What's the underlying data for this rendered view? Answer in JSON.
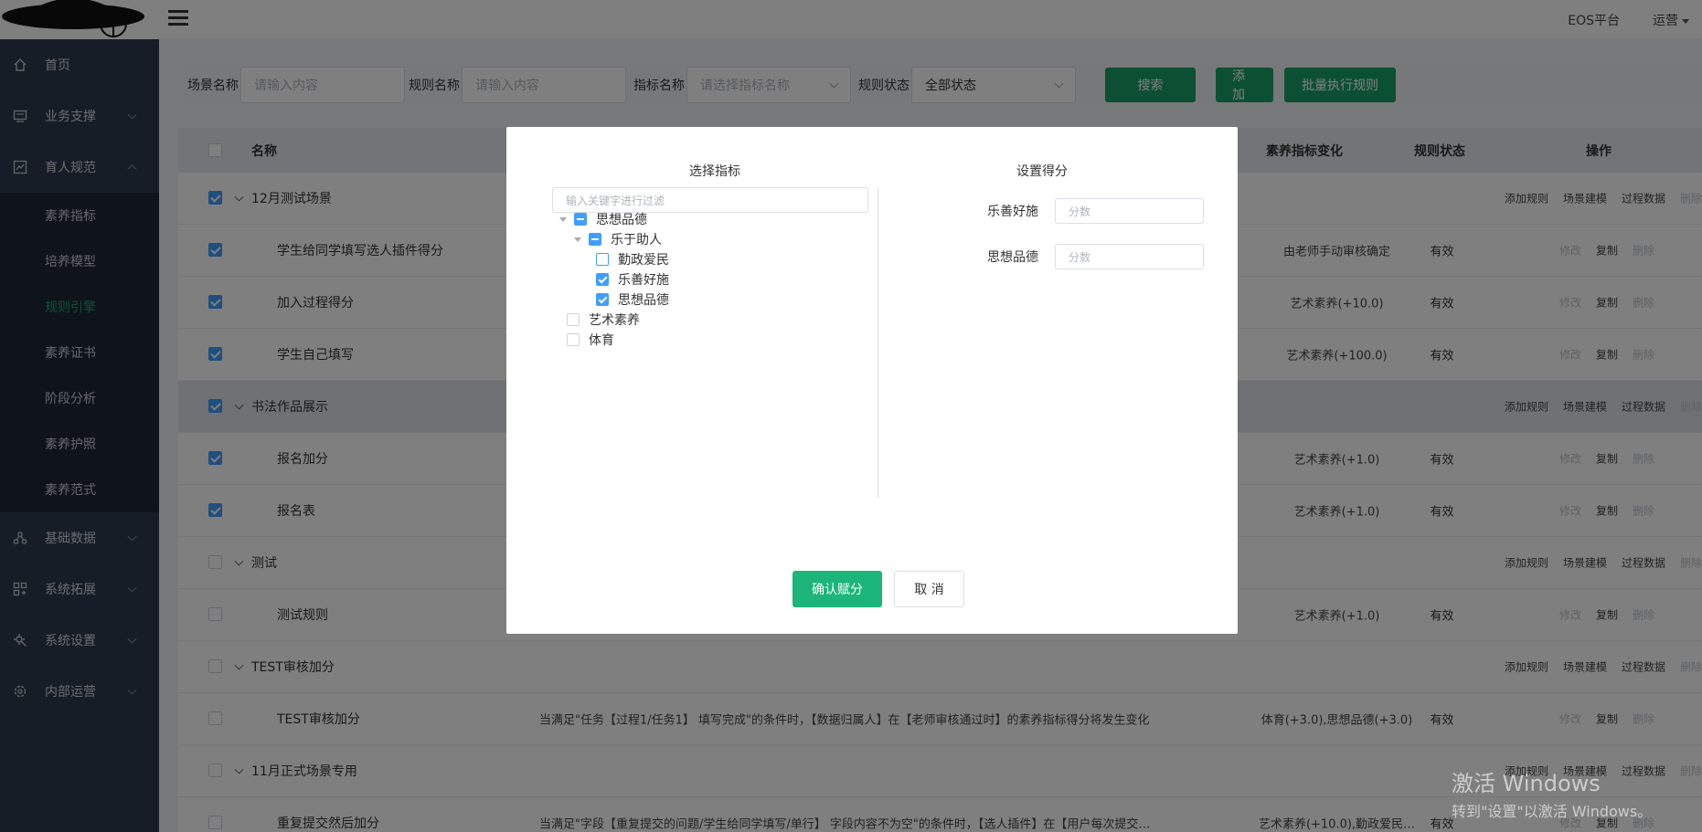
{
  "topbar": {
    "platform": "EOS平台",
    "user": "运营"
  },
  "sidebar": {
    "items": [
      {
        "label": "首页",
        "icon": "home-icon"
      },
      {
        "label": "业务支撑",
        "icon": "monitor-icon"
      },
      {
        "label": "育人规范",
        "icon": "chart-icon"
      },
      {
        "label": "基础数据",
        "icon": "network-icon"
      },
      {
        "label": "系统拓展",
        "icon": "extend-icon"
      },
      {
        "label": "系统设置",
        "icon": "settings-icon"
      },
      {
        "label": "内部运营",
        "icon": "gear-icon"
      }
    ],
    "submenu": [
      "素养指标",
      "培养模型",
      "规则引擎",
      "素养证书",
      "阶段分析",
      "素养护照",
      "素养范式"
    ]
  },
  "filters": {
    "scene_label": "场景名称",
    "scene_placeholder": "请输入内容",
    "rule_label": "规则名称",
    "rule_placeholder": "请输入内容",
    "indicator_label": "指标名称",
    "indicator_placeholder": "请选择指标名称",
    "status_label": "规则状态",
    "status_value": "全部状态",
    "search": "搜索",
    "add": "添加",
    "batch": "批量执行规则"
  },
  "table": {
    "headers": {
      "name": "名称",
      "change": "素养指标变化",
      "status": "规则状态",
      "ops": "操作"
    },
    "group_ops": [
      "添加规则",
      "场景建模",
      "过程数据",
      "删除"
    ],
    "row_ops": [
      "修改",
      "复制",
      "删除"
    ],
    "rows": [
      {
        "type": "group",
        "name": "12月测试场景",
        "checked": true,
        "desc": "",
        "change": "",
        "status": ""
      },
      {
        "type": "rule",
        "name": "学生给同学填写选人插件得分",
        "checked": true,
        "desc": "",
        "change": "由老师手动审核确定",
        "status": "有效"
      },
      {
        "type": "rule",
        "name": "加入过程得分",
        "checked": true,
        "desc": "",
        "change": "艺术素养(+10.0)",
        "status": "有效"
      },
      {
        "type": "rule",
        "name": "学生自己填写",
        "checked": true,
        "desc": "",
        "change": "艺术素养(+100.0)",
        "status": "有效"
      },
      {
        "type": "group",
        "name": "书法作品展示",
        "checked": true,
        "desc": "",
        "change": "",
        "status": ""
      },
      {
        "type": "rule",
        "name": "报名加分",
        "checked": true,
        "desc": "",
        "change": "艺术素养(+1.0)",
        "status": "有效"
      },
      {
        "type": "rule",
        "name": "报名表",
        "checked": true,
        "desc": "",
        "change": "艺术素养(+1.0)",
        "status": "有效"
      },
      {
        "type": "group",
        "name": "测试",
        "checked": false,
        "desc": "",
        "change": "",
        "status": ""
      },
      {
        "type": "rule",
        "name": "测试规则",
        "checked": false,
        "desc": "",
        "change": "艺术素养(+1.0)",
        "status": "有效"
      },
      {
        "type": "group",
        "name": "TEST审核加分",
        "checked": false,
        "desc": "",
        "change": "",
        "status": ""
      },
      {
        "type": "rule",
        "name": "TEST审核加分",
        "checked": false,
        "desc": "当满足\"任务【过程1/任务1】 填写完成\"的条件时，【数据归属人】在【老师审核通过时】的素养指标得分将发生变化",
        "change": "体育(+3.0),思想品德(+3.0)",
        "status": "有效"
      },
      {
        "type": "group",
        "name": "11月正式场景专用",
        "checked": false,
        "desc": "",
        "change": "",
        "status": ""
      },
      {
        "type": "rule",
        "name": "重复提交然后加分",
        "checked": false,
        "desc": "当满足\"字段【重复提交的问题/学生给同学填写/单行】 字段内容不为空\"的条件时，【选人插件】在【用户每次提交…",
        "change": "艺术素养(+10.0),勤政爱民…",
        "status": "有效"
      }
    ]
  },
  "modal": {
    "left_title": "选择指标",
    "right_title": "设置得分",
    "filter_placeholder": "输入关键字进行过滤",
    "tree": [
      {
        "label": "思想品德",
        "level": 0,
        "state": "half",
        "arrow": true
      },
      {
        "label": "乐于助人",
        "level": 1,
        "state": "half",
        "arrow": true
      },
      {
        "label": "勤政爱民",
        "level": 2,
        "state": "focus",
        "arrow": false
      },
      {
        "label": "乐善好施",
        "level": 2,
        "state": "on",
        "arrow": false
      },
      {
        "label": "思想品德",
        "level": 2,
        "state": "on",
        "arrow": false
      },
      {
        "label": "艺术素养",
        "level": 0,
        "state": "off",
        "arrow": false
      },
      {
        "label": "体育",
        "level": 0,
        "state": "off",
        "arrow": false
      }
    ],
    "scores": [
      {
        "label": "乐善好施",
        "placeholder": "分数"
      },
      {
        "label": "思想品德",
        "placeholder": "分数"
      }
    ],
    "confirm": "确认赋分",
    "cancel": "取 消"
  },
  "watermark": {
    "line1": "激活 Windows",
    "line2": "转到\"设置\"以激活 Windows。"
  }
}
